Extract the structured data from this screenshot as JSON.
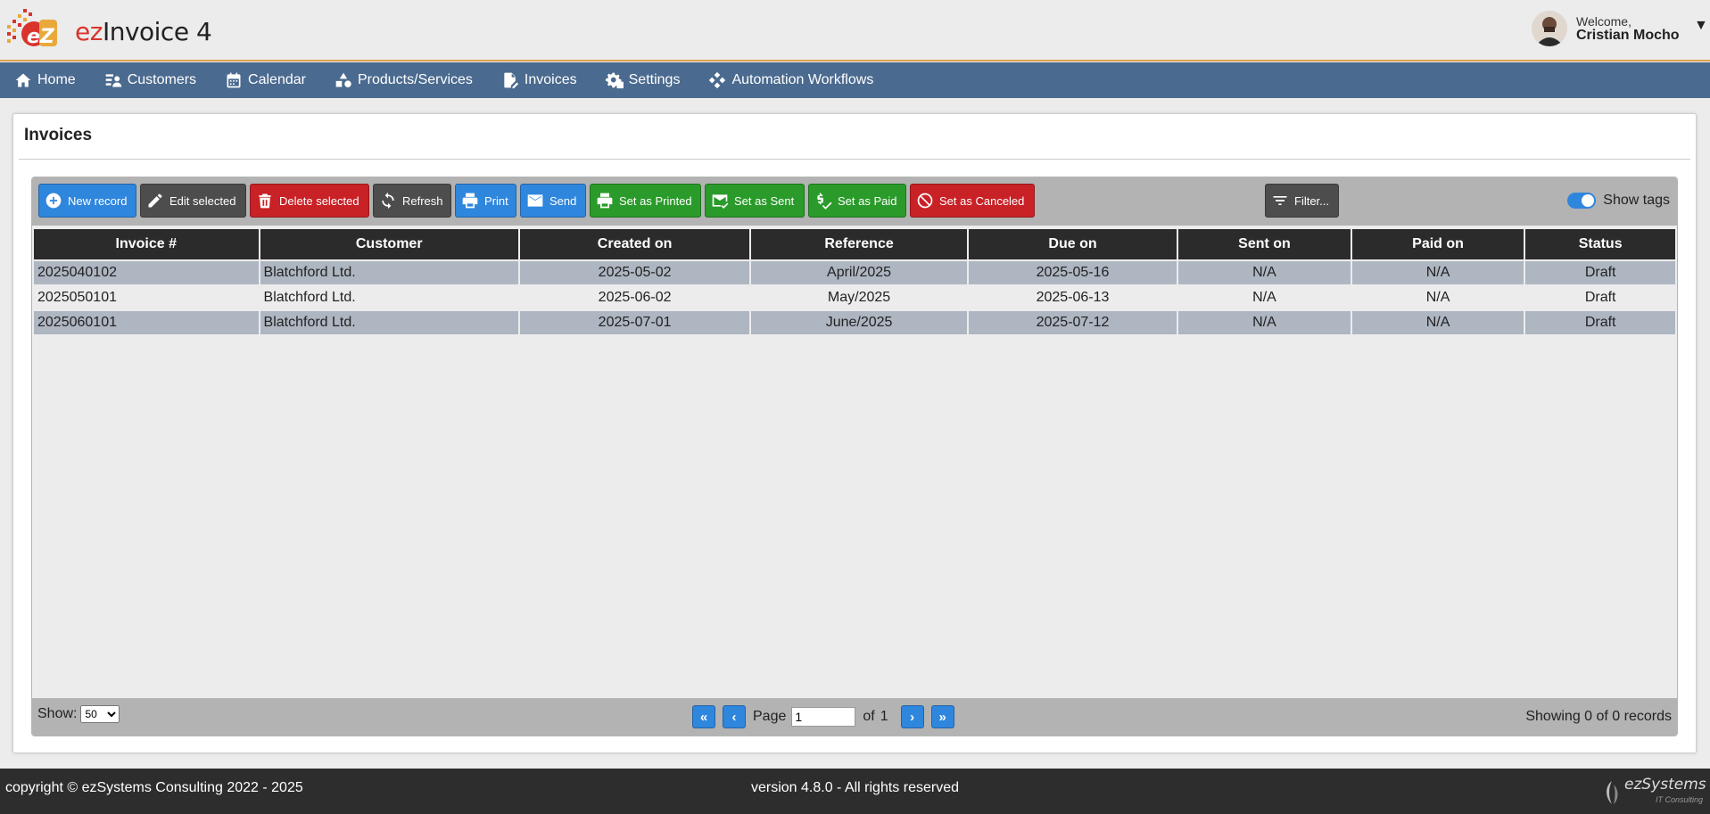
{
  "app": {
    "title_prefix": "ez",
    "title_rest": "Invoice 4"
  },
  "user": {
    "welcome": "Welcome,",
    "name": "Cristian Mocho"
  },
  "nav": {
    "home": "Home",
    "customers": "Customers",
    "calendar": "Calendar",
    "products": "Products/Services",
    "invoices": "Invoices",
    "settings": "Settings",
    "workflows": "Automation Workflows"
  },
  "page": {
    "title": "Invoices"
  },
  "toolbar": {
    "new_record": "New record",
    "edit_selected": "Edit selected",
    "delete_selected": "Delete selected",
    "refresh": "Refresh",
    "print": "Print",
    "send": "Send",
    "set_printed": "Set as Printed",
    "set_sent": "Set as Sent",
    "set_paid": "Set as Paid",
    "set_canceled": "Set as Canceled",
    "filter": "Filter...",
    "show_tags": "Show tags"
  },
  "table": {
    "headers": [
      "Invoice #",
      "Customer",
      "Created on",
      "Reference",
      "Due on",
      "Sent on",
      "Paid on",
      "Status"
    ],
    "rows": [
      [
        "2025040102",
        "Blatchford Ltd.",
        "2025-05-02",
        "April/2025",
        "2025-05-16",
        "N/A",
        "N/A",
        "Draft"
      ],
      [
        "2025050101",
        "Blatchford Ltd.",
        "2025-06-02",
        "May/2025",
        "2025-06-13",
        "N/A",
        "N/A",
        "Draft"
      ],
      [
        "2025060101",
        "Blatchford Ltd.",
        "2025-07-01",
        "June/2025",
        "2025-07-12",
        "N/A",
        "N/A",
        "Draft"
      ]
    ]
  },
  "pager": {
    "show_label": "Show:",
    "page_size": "50",
    "page_label": "Page",
    "page_value": "1",
    "of_label": "of",
    "total_pages": "1",
    "first": "«",
    "prev": "‹",
    "next": "›",
    "last": "»",
    "records": "Showing 0 of 0 records"
  },
  "footer": {
    "copyright": "copyright © ezSystems Consulting 2022 - 2025",
    "version": "version 4.8.0 - All rights reserved",
    "company": "ezSystems",
    "company_sub": "IT Consulting"
  },
  "colors": {
    "nav": "#4a6a8f",
    "blue_button": "#2f86dd",
    "red_button": "#c82126",
    "green_button": "#2a9b2a",
    "dark_button": "#4d4d4d",
    "odd_row": "#aeb6c2"
  }
}
